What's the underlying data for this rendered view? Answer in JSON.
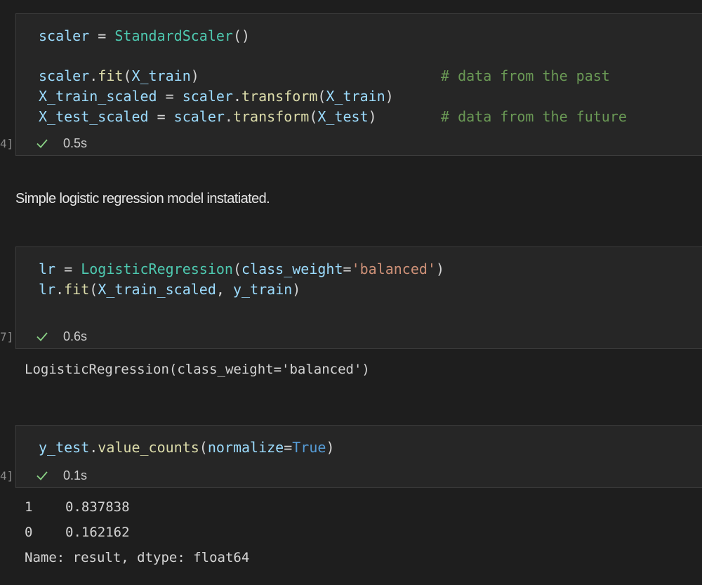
{
  "cell1": {
    "exec_count": "4]",
    "duration": "0.5s",
    "lines": [
      [
        [
          "v",
          "scaler"
        ],
        [
          "p",
          " = "
        ],
        [
          "c",
          "StandardScaler"
        ],
        [
          "p",
          "()"
        ]
      ],
      [],
      [
        [
          "v",
          "scaler"
        ],
        [
          "p",
          "."
        ],
        [
          "f",
          "fit"
        ],
        [
          "p",
          "("
        ],
        [
          "v",
          "X_train"
        ],
        [
          "p",
          ")"
        ]
      ],
      [
        [
          "v",
          "X_train_scaled"
        ],
        [
          "p",
          " = "
        ],
        [
          "v",
          "scaler"
        ],
        [
          "p",
          "."
        ],
        [
          "f",
          "transform"
        ],
        [
          "p",
          "("
        ],
        [
          "v",
          "X_train"
        ],
        [
          "p",
          ")"
        ]
      ],
      [
        [
          "v",
          "X_test_scaled"
        ],
        [
          "p",
          " = "
        ],
        [
          "v",
          "scaler"
        ],
        [
          "p",
          "."
        ],
        [
          "f",
          "transform"
        ],
        [
          "p",
          "("
        ],
        [
          "v",
          "X_test"
        ],
        [
          "p",
          ")"
        ]
      ]
    ],
    "comment_past": "# data from the past",
    "comment_future": "# data from the future"
  },
  "markdown": {
    "text": "Simple logistic regression model instatiated."
  },
  "cell2": {
    "exec_count": "7]",
    "duration": "0.6s",
    "lines": [
      [
        [
          "v",
          "lr"
        ],
        [
          "p",
          " = "
        ],
        [
          "c",
          "LogisticRegression"
        ],
        [
          "p",
          "("
        ],
        [
          "v",
          "class_weight"
        ],
        [
          "p",
          "="
        ],
        [
          "s",
          "'balanced'"
        ],
        [
          "p",
          ")"
        ]
      ],
      [
        [
          "v",
          "lr"
        ],
        [
          "p",
          "."
        ],
        [
          "f",
          "fit"
        ],
        [
          "p",
          "("
        ],
        [
          "v",
          "X_train_scaled"
        ],
        [
          "p",
          ", "
        ],
        [
          "v",
          "y_train"
        ],
        [
          "p",
          ")"
        ]
      ]
    ],
    "output": "LogisticRegression(class_weight='balanced')"
  },
  "cell3": {
    "exec_count": "4]",
    "duration": "0.1s",
    "lines": [
      [
        [
          "v",
          "y_test"
        ],
        [
          "p",
          "."
        ],
        [
          "f",
          "value_counts"
        ],
        [
          "p",
          "("
        ],
        [
          "v",
          "normalize"
        ],
        [
          "p",
          "="
        ],
        [
          "k",
          "True"
        ],
        [
          "p",
          ")"
        ]
      ]
    ],
    "output_rows": [
      {
        "index": "1",
        "value": "0.837838"
      },
      {
        "index": "0",
        "value": "0.162162"
      }
    ],
    "output_footer": "Name: result, dtype: float64"
  },
  "colors": {
    "background": "#1e1e1e",
    "cell_background": "#262626",
    "check_green": "#89d185"
  }
}
